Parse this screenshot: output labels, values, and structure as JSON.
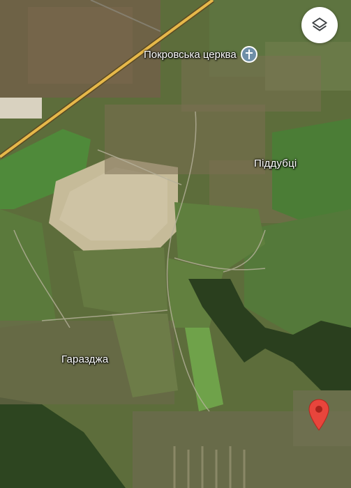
{
  "map": {
    "places": {
      "piddubtsi": "Піддубці",
      "garazdzha": "Гаразджа"
    },
    "poi": {
      "name": "Покровська церква",
      "icon": "church-cross-icon"
    },
    "controls": {
      "layers_icon": "layers-icon"
    },
    "marker": {
      "icon": "location-pin-icon",
      "color": "#e8453c"
    },
    "colors": {
      "road": "#e6b84a",
      "field_green": "#4f8a3a",
      "field_pale": "#c9c0a2",
      "forest": "#2a3f1e",
      "poi_badge": "#6f8fa8"
    }
  }
}
